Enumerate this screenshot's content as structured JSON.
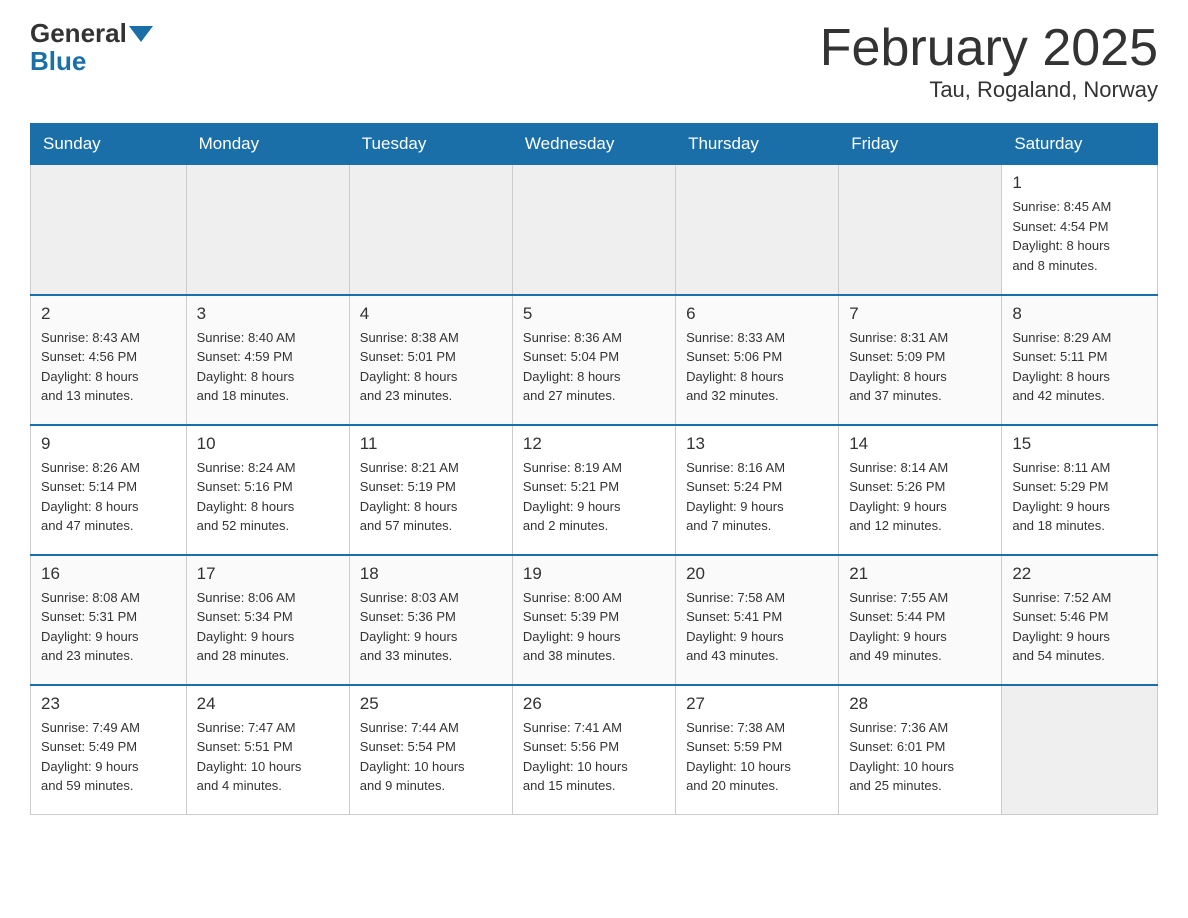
{
  "header": {
    "logo_general": "General",
    "logo_blue": "Blue",
    "month_title": "February 2025",
    "location": "Tau, Rogaland, Norway"
  },
  "weekdays": [
    "Sunday",
    "Monday",
    "Tuesday",
    "Wednesday",
    "Thursday",
    "Friday",
    "Saturday"
  ],
  "weeks": [
    [
      {
        "day": "",
        "info": "",
        "empty": true
      },
      {
        "day": "",
        "info": "",
        "empty": true
      },
      {
        "day": "",
        "info": "",
        "empty": true
      },
      {
        "day": "",
        "info": "",
        "empty": true
      },
      {
        "day": "",
        "info": "",
        "empty": true
      },
      {
        "day": "",
        "info": "",
        "empty": true
      },
      {
        "day": "1",
        "info": "Sunrise: 8:45 AM\nSunset: 4:54 PM\nDaylight: 8 hours\nand 8 minutes.",
        "empty": false
      }
    ],
    [
      {
        "day": "2",
        "info": "Sunrise: 8:43 AM\nSunset: 4:56 PM\nDaylight: 8 hours\nand 13 minutes.",
        "empty": false
      },
      {
        "day": "3",
        "info": "Sunrise: 8:40 AM\nSunset: 4:59 PM\nDaylight: 8 hours\nand 18 minutes.",
        "empty": false
      },
      {
        "day": "4",
        "info": "Sunrise: 8:38 AM\nSunset: 5:01 PM\nDaylight: 8 hours\nand 23 minutes.",
        "empty": false
      },
      {
        "day": "5",
        "info": "Sunrise: 8:36 AM\nSunset: 5:04 PM\nDaylight: 8 hours\nand 27 minutes.",
        "empty": false
      },
      {
        "day": "6",
        "info": "Sunrise: 8:33 AM\nSunset: 5:06 PM\nDaylight: 8 hours\nand 32 minutes.",
        "empty": false
      },
      {
        "day": "7",
        "info": "Sunrise: 8:31 AM\nSunset: 5:09 PM\nDaylight: 8 hours\nand 37 minutes.",
        "empty": false
      },
      {
        "day": "8",
        "info": "Sunrise: 8:29 AM\nSunset: 5:11 PM\nDaylight: 8 hours\nand 42 minutes.",
        "empty": false
      }
    ],
    [
      {
        "day": "9",
        "info": "Sunrise: 8:26 AM\nSunset: 5:14 PM\nDaylight: 8 hours\nand 47 minutes.",
        "empty": false
      },
      {
        "day": "10",
        "info": "Sunrise: 8:24 AM\nSunset: 5:16 PM\nDaylight: 8 hours\nand 52 minutes.",
        "empty": false
      },
      {
        "day": "11",
        "info": "Sunrise: 8:21 AM\nSunset: 5:19 PM\nDaylight: 8 hours\nand 57 minutes.",
        "empty": false
      },
      {
        "day": "12",
        "info": "Sunrise: 8:19 AM\nSunset: 5:21 PM\nDaylight: 9 hours\nand 2 minutes.",
        "empty": false
      },
      {
        "day": "13",
        "info": "Sunrise: 8:16 AM\nSunset: 5:24 PM\nDaylight: 9 hours\nand 7 minutes.",
        "empty": false
      },
      {
        "day": "14",
        "info": "Sunrise: 8:14 AM\nSunset: 5:26 PM\nDaylight: 9 hours\nand 12 minutes.",
        "empty": false
      },
      {
        "day": "15",
        "info": "Sunrise: 8:11 AM\nSunset: 5:29 PM\nDaylight: 9 hours\nand 18 minutes.",
        "empty": false
      }
    ],
    [
      {
        "day": "16",
        "info": "Sunrise: 8:08 AM\nSunset: 5:31 PM\nDaylight: 9 hours\nand 23 minutes.",
        "empty": false
      },
      {
        "day": "17",
        "info": "Sunrise: 8:06 AM\nSunset: 5:34 PM\nDaylight: 9 hours\nand 28 minutes.",
        "empty": false
      },
      {
        "day": "18",
        "info": "Sunrise: 8:03 AM\nSunset: 5:36 PM\nDaylight: 9 hours\nand 33 minutes.",
        "empty": false
      },
      {
        "day": "19",
        "info": "Sunrise: 8:00 AM\nSunset: 5:39 PM\nDaylight: 9 hours\nand 38 minutes.",
        "empty": false
      },
      {
        "day": "20",
        "info": "Sunrise: 7:58 AM\nSunset: 5:41 PM\nDaylight: 9 hours\nand 43 minutes.",
        "empty": false
      },
      {
        "day": "21",
        "info": "Sunrise: 7:55 AM\nSunset: 5:44 PM\nDaylight: 9 hours\nand 49 minutes.",
        "empty": false
      },
      {
        "day": "22",
        "info": "Sunrise: 7:52 AM\nSunset: 5:46 PM\nDaylight: 9 hours\nand 54 minutes.",
        "empty": false
      }
    ],
    [
      {
        "day": "23",
        "info": "Sunrise: 7:49 AM\nSunset: 5:49 PM\nDaylight: 9 hours\nand 59 minutes.",
        "empty": false
      },
      {
        "day": "24",
        "info": "Sunrise: 7:47 AM\nSunset: 5:51 PM\nDaylight: 10 hours\nand 4 minutes.",
        "empty": false
      },
      {
        "day": "25",
        "info": "Sunrise: 7:44 AM\nSunset: 5:54 PM\nDaylight: 10 hours\nand 9 minutes.",
        "empty": false
      },
      {
        "day": "26",
        "info": "Sunrise: 7:41 AM\nSunset: 5:56 PM\nDaylight: 10 hours\nand 15 minutes.",
        "empty": false
      },
      {
        "day": "27",
        "info": "Sunrise: 7:38 AM\nSunset: 5:59 PM\nDaylight: 10 hours\nand 20 minutes.",
        "empty": false
      },
      {
        "day": "28",
        "info": "Sunrise: 7:36 AM\nSunset: 6:01 PM\nDaylight: 10 hours\nand 25 minutes.",
        "empty": false
      },
      {
        "day": "",
        "info": "",
        "empty": true
      }
    ]
  ]
}
